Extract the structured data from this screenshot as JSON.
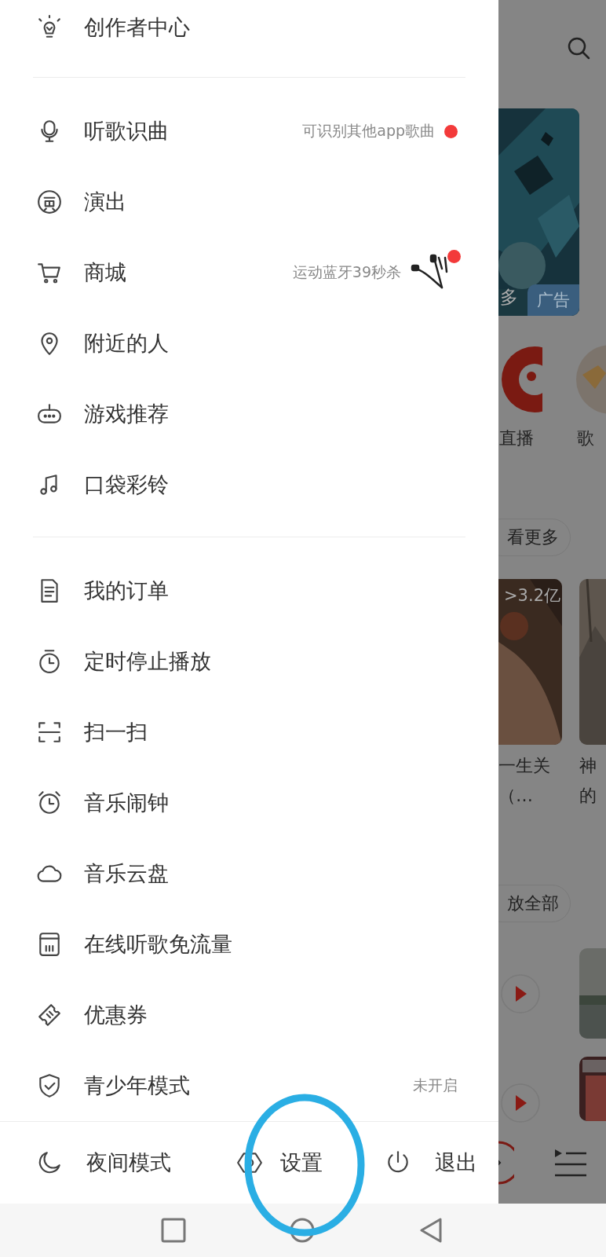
{
  "drawer": {
    "sections": [
      [
        {
          "label": "创作者中心"
        }
      ],
      [
        {
          "label": "听歌识曲",
          "note": "可识别其他app歌曲",
          "dot": true
        },
        {
          "label": "演出"
        },
        {
          "label": "商城",
          "note": "运动蓝牙39秒杀",
          "dot": true
        },
        {
          "label": "附近的人"
        },
        {
          "label": "游戏推荐"
        },
        {
          "label": "口袋彩铃"
        }
      ],
      [
        {
          "label": "我的订单"
        },
        {
          "label": "定时停止播放"
        },
        {
          "label": "扫一扫"
        },
        {
          "label": "音乐闹钟"
        },
        {
          "label": "音乐云盘"
        },
        {
          "label": "在线听歌免流量"
        },
        {
          "label": "优惠券"
        },
        {
          "label": "青少年模式",
          "note": "未开启"
        }
      ]
    ],
    "bottom_actions": [
      {
        "label": "夜间模式"
      },
      {
        "label": "设置"
      },
      {
        "label": "退出"
      }
    ]
  },
  "background": {
    "banner": {
      "caption": "多",
      "badge": "广告"
    },
    "shortcuts": [
      "直播",
      "歌"
    ],
    "more_button": "看更多",
    "playlists": [
      {
        "plays": ">3.2亿",
        "title_lines": [
          "一生关",
          "（…"
        ]
      },
      {
        "title_lines": [
          "神",
          "的"
        ]
      }
    ],
    "play_all_button": "放全部"
  }
}
